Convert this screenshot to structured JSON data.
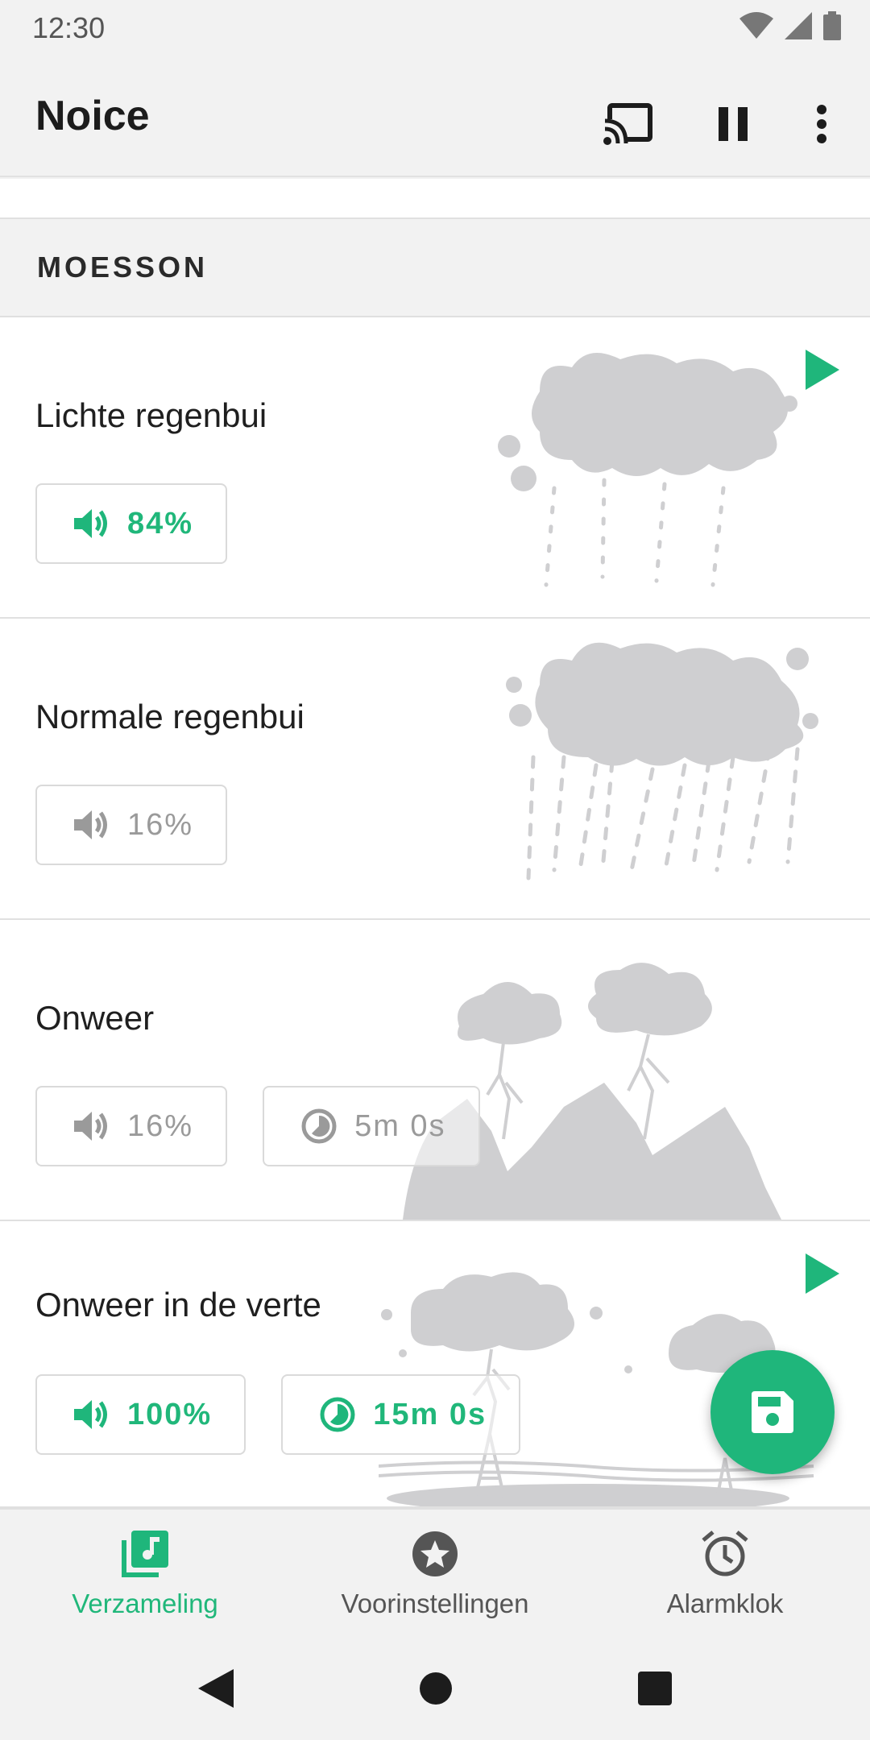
{
  "status_bar": {
    "time": "12:30"
  },
  "app_bar": {
    "title": "Noice",
    "actions": [
      "cast-icon",
      "pause-icon",
      "more-vert-icon"
    ]
  },
  "section": {
    "title": "MOESSON"
  },
  "sounds": [
    {
      "title": "Lichte regenbui",
      "volume": "84%",
      "active": true,
      "playing": true
    },
    {
      "title": "Normale regenbui",
      "volume": "16%",
      "active": false,
      "playing": false
    },
    {
      "title": "Onweer",
      "volume": "16%",
      "timer": "5m 0s",
      "active": false,
      "playing": false
    },
    {
      "title": "Onweer in de verte",
      "volume": "100%",
      "timer": "15m 0s",
      "active": true,
      "playing": true
    }
  ],
  "fab": {
    "icon": "save-icon"
  },
  "bottom_nav": [
    {
      "label": "Verzameling",
      "icon": "library-music-icon",
      "active": true
    },
    {
      "label": "Voorinstellingen",
      "icon": "star-badge-icon",
      "active": false
    },
    {
      "label": "Alarmklok",
      "icon": "alarm-clock-icon",
      "active": false
    }
  ],
  "colors": {
    "accent": "#1fb67b",
    "inactive": "#9a9a9a",
    "art": "#cfcfd1"
  }
}
